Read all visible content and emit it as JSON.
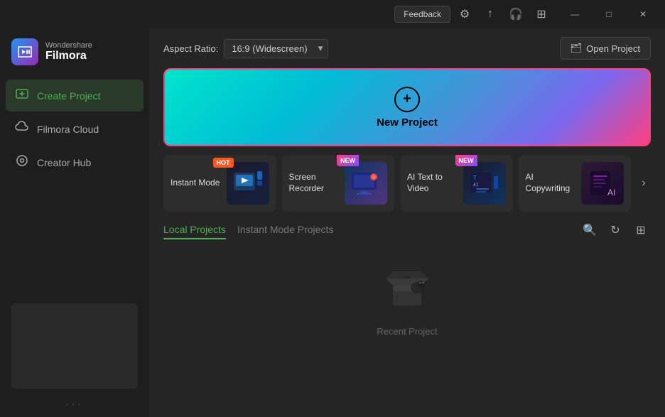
{
  "titleBar": {
    "feedback": "Feedback",
    "winButtons": {
      "minimize": "—",
      "maximize": "□",
      "close": "✕"
    }
  },
  "sidebar": {
    "brand": "Wondershare",
    "product": "Filmora",
    "navItems": [
      {
        "id": "create-project",
        "label": "Create Project",
        "icon": "⊞",
        "active": true
      },
      {
        "id": "filmora-cloud",
        "label": "Filmora Cloud",
        "icon": "☁",
        "active": false
      },
      {
        "id": "creator-hub",
        "label": "Creator Hub",
        "icon": "◎",
        "active": false
      }
    ],
    "dots": "..."
  },
  "topBar": {
    "aspectRatioLabel": "Aspect Ratio:",
    "aspectRatioValue": "16:9 (Widescreen)",
    "openProjectLabel": "Open Project",
    "folderIcon": "🗂"
  },
  "newProject": {
    "label": "New Project",
    "plusIcon": "+"
  },
  "quickAccess": [
    {
      "id": "instant-mode",
      "label": "Instant Mode",
      "badge": "HOT",
      "badgeType": "hot",
      "emoji": "🎬"
    },
    {
      "id": "screen-recorder",
      "label": "Screen Recorder",
      "badge": "NEW",
      "badgeType": "new",
      "emoji": "🎥"
    },
    {
      "id": "ai-text-video",
      "label": "AI Text to Video",
      "badge": "NEW",
      "badgeType": "new",
      "emoji": "🤖"
    },
    {
      "id": "ai-copywriting",
      "label": "AI Copywriting",
      "badge": "",
      "badgeType": "",
      "emoji": "✍"
    }
  ],
  "moreArrow": "›",
  "projects": {
    "tabs": [
      {
        "id": "local",
        "label": "Local Projects",
        "active": true
      },
      {
        "id": "instant",
        "label": "Instant Mode Projects",
        "active": false
      }
    ],
    "actions": {
      "search": "🔍",
      "refresh": "↻",
      "grid": "⊞"
    },
    "emptyState": {
      "label": "Recent Project"
    }
  }
}
